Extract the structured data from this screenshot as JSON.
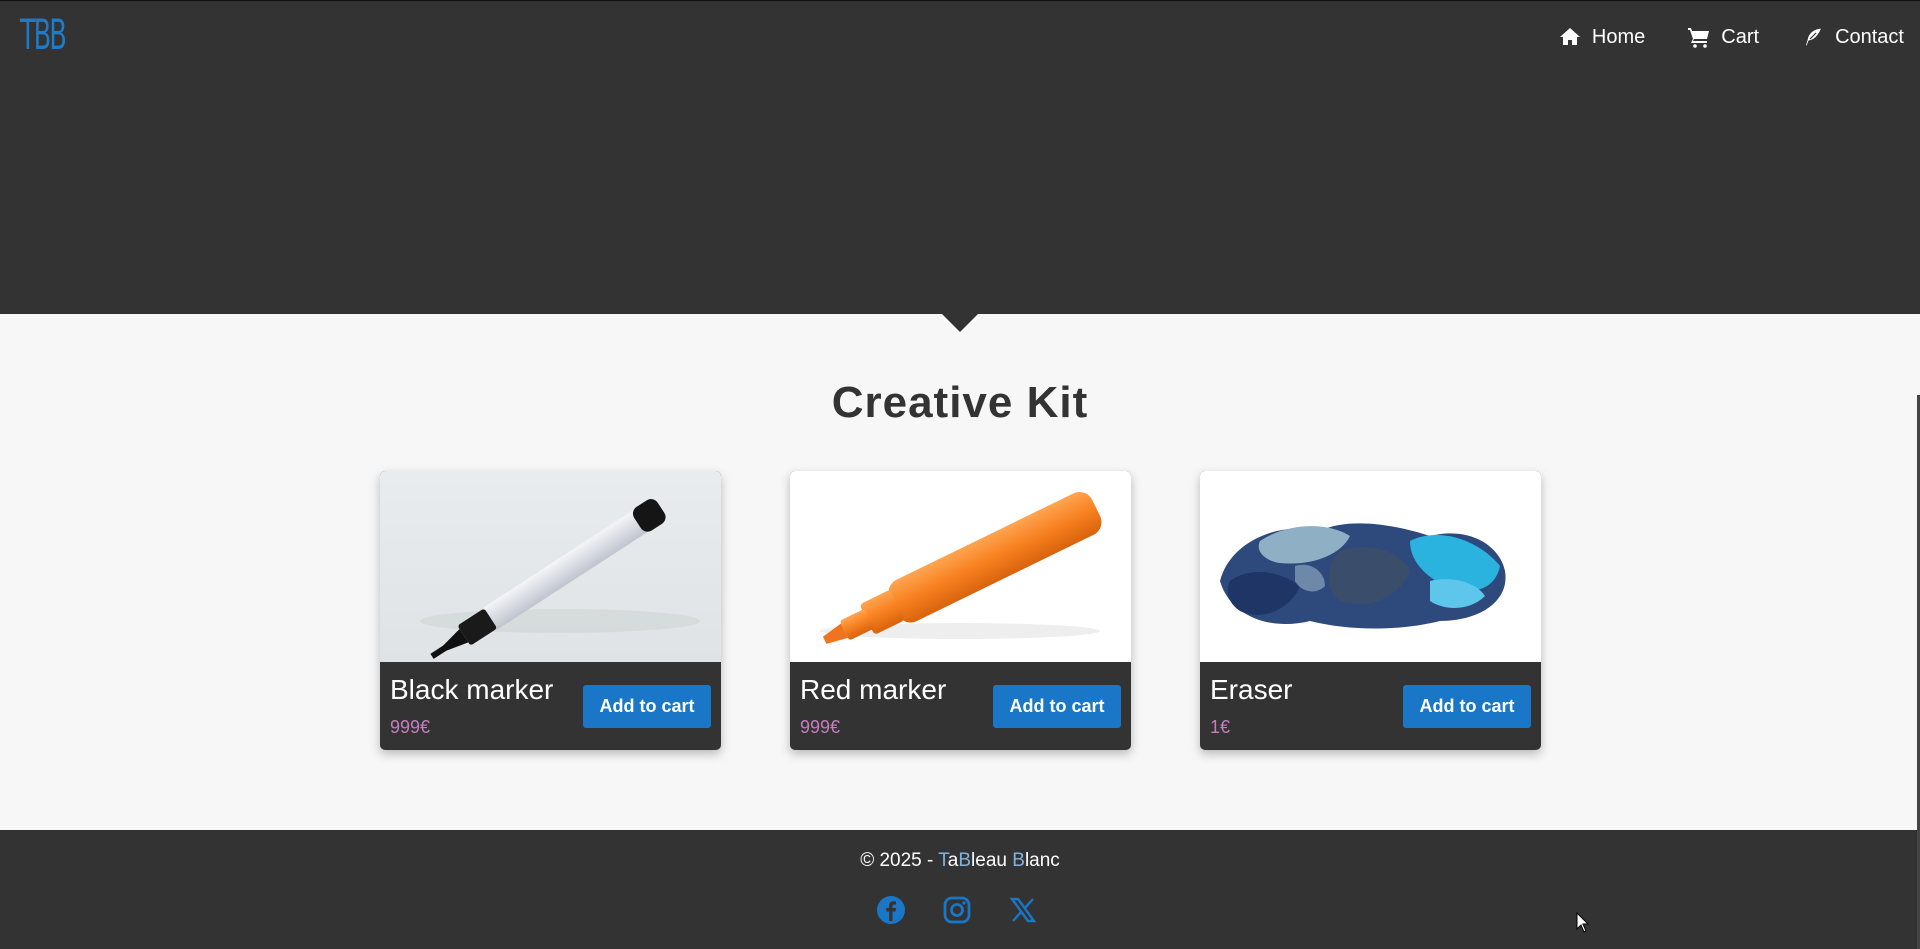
{
  "brand": "TBB",
  "nav": [
    {
      "label": "Home",
      "icon": "home-icon"
    },
    {
      "label": "Cart",
      "icon": "cart-icon"
    },
    {
      "label": "Contact",
      "icon": "feather-icon"
    }
  ],
  "section_title": "Creative Kit",
  "products": [
    {
      "name": "Black marker",
      "price": "999€",
      "button": "Add to cart",
      "image": "black-marker-image"
    },
    {
      "name": "Red marker",
      "price": "999€",
      "button": "Add to cart",
      "image": "orange-marker-image"
    },
    {
      "name": "Eraser",
      "price": "1€",
      "button": "Add to cart",
      "image": "cloth-eraser-image"
    }
  ],
  "footer": {
    "copyright_prefix": "© 2025 - ",
    "name_parts": [
      "T",
      "a",
      "B",
      "leau ",
      "B",
      "lanc"
    ],
    "socials": [
      "facebook-icon",
      "instagram-icon",
      "x-icon"
    ]
  },
  "colors": {
    "dark": "#333333",
    "accent": "#1a76c6",
    "price": "#c77dc0",
    "background": "#f7f7f7"
  }
}
